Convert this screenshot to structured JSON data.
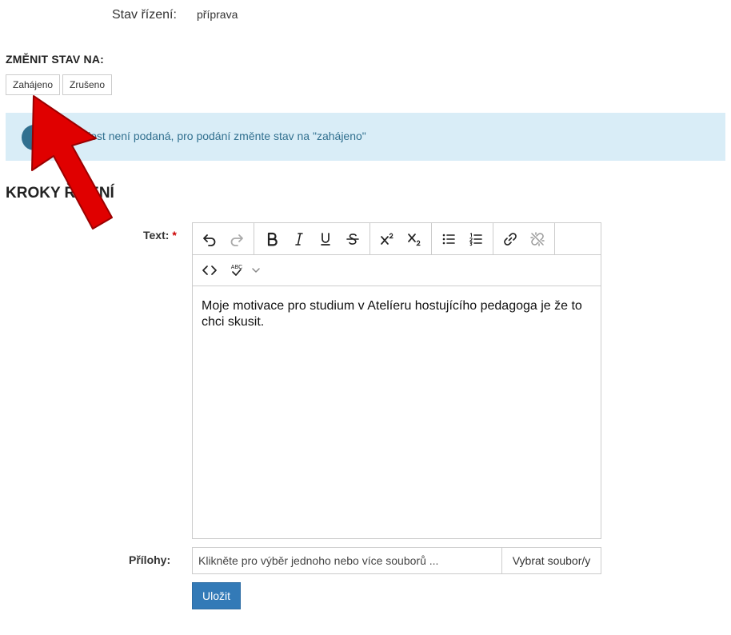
{
  "status": {
    "label": "Stav řízení:",
    "value": "příprava"
  },
  "change_state": {
    "heading": "ZMĚNIT STAV NA:",
    "buttons": [
      "Zahájeno",
      "Zrušeno"
    ]
  },
  "alert": {
    "text": "Žádost není podaná, pro podání změnte stav na \"zahájeno\""
  },
  "steps": {
    "heading": "KROKY ŘÍZENÍ"
  },
  "editor": {
    "label": "Text:",
    "required_mark": "*",
    "content": "Moje motivace pro studium v Atelíeru hostujícího pedagoga je že to chci skusit.",
    "spellcheck_badge": "ABC"
  },
  "attachments": {
    "label": "Přílohy:",
    "placeholder": "Klikněte pro výběr jednoho nebo více souborů ...",
    "button": "Vybrat soubor/y"
  },
  "save_button": "Uložit",
  "colors": {
    "alert_bg": "#d9edf7",
    "alert_text": "#31708f",
    "primary": "#337ab7",
    "required": "#cc0000",
    "annotation_arrow": "#e00000"
  }
}
